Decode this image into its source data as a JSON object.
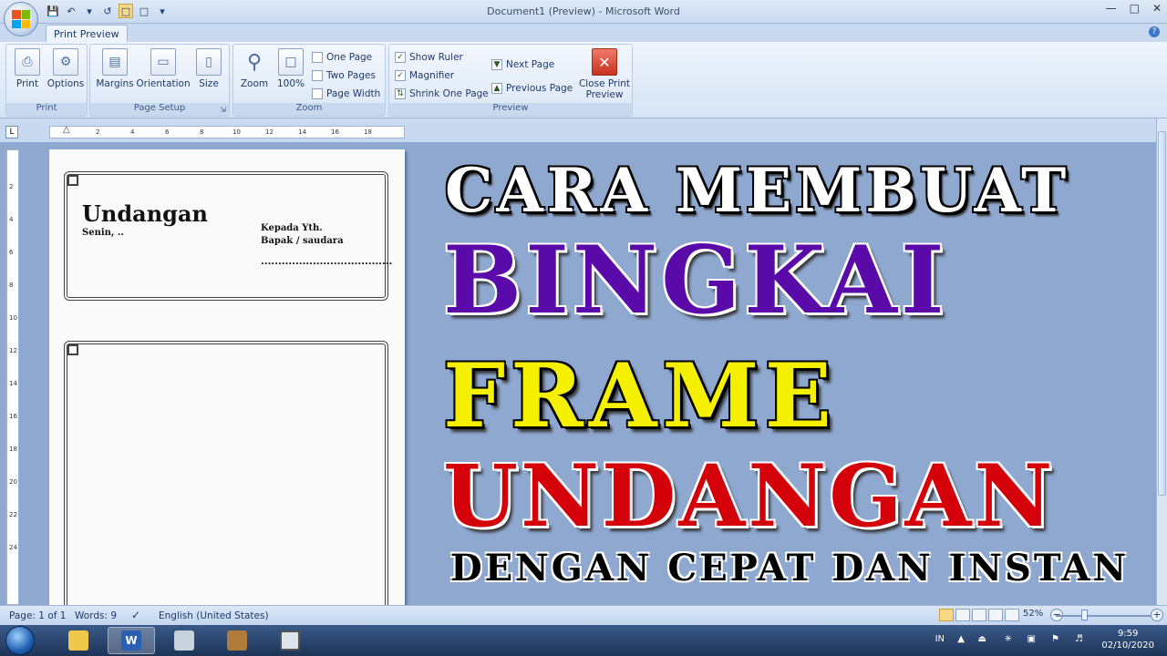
{
  "window": {
    "title": "Document1 (Preview) - Microsoft Word"
  },
  "ribbon": {
    "active_tab": "Print Preview",
    "groups": {
      "print": {
        "label": "Print",
        "print_btn": "Print",
        "options_btn": "Options"
      },
      "page_setup": {
        "label": "Page Setup",
        "margins_btn": "Margins",
        "orientation_btn": "Orientation",
        "size_btn": "Size"
      },
      "zoom": {
        "label": "Zoom",
        "zoom_btn": "Zoom",
        "pct_btn": "100%",
        "one_page": "One Page",
        "two_pages": "Two Pages",
        "page_width": "Page Width"
      },
      "preview": {
        "label": "Preview",
        "show_ruler": "Show Ruler",
        "magnifier": "Magnifier",
        "shrink": "Shrink One Page",
        "next_page": "Next Page",
        "previous_page": "Previous Page",
        "close_line1": "Close Print",
        "close_line2": "Preview"
      }
    }
  },
  "ruler": {
    "h_ticks": [
      "2",
      "4",
      "6",
      "8",
      "10",
      "12",
      "14",
      "16",
      "18"
    ],
    "v_ticks": [
      "2",
      "4",
      "6",
      "8",
      "10",
      "12",
      "14",
      "16",
      "18",
      "20",
      "22",
      "24"
    ]
  },
  "document": {
    "title": "Undangan",
    "greeting": "Senin, ..",
    "to_line1": "Kepada Yth.",
    "to_line2": "Bapak / saudara",
    "dots": "......................................"
  },
  "overlay": {
    "line1": "CARA MEMBUAT",
    "line2": "BINGKAI",
    "line3": "FRAME",
    "line4": "UNDANGAN",
    "line5": "DENGAN CEPAT DAN INSTAN",
    "colors": {
      "line2": "#5a0aa8",
      "line3": "#f4f000",
      "line4": "#d4000a"
    }
  },
  "statusbar": {
    "page": "Page: 1 of 1",
    "words": "Words: 9",
    "language": "English (United States)",
    "zoom": "52%"
  },
  "taskbar": {
    "lang": "IN",
    "time": "9:59",
    "date": "02/10/2020"
  }
}
